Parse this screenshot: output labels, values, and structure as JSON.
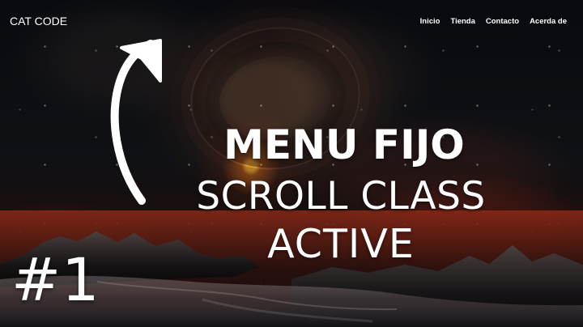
{
  "nav": {
    "brand": "CAT CODE",
    "links": [
      "Inicio",
      "Tienda",
      "Contacto",
      "Acerda de"
    ]
  },
  "hero": {
    "title_main": "MENU FIJO",
    "title_sub": "SCROLL CLASS",
    "title_active": "ACTIVE",
    "episode": "#1"
  },
  "icons": {
    "arrow": "up-arrow-icon"
  },
  "colors": {
    "text": "#ffffff",
    "accent_glow": "#ffb028",
    "background_dark": "#05070b",
    "horizon_red": "#7b2416"
  }
}
